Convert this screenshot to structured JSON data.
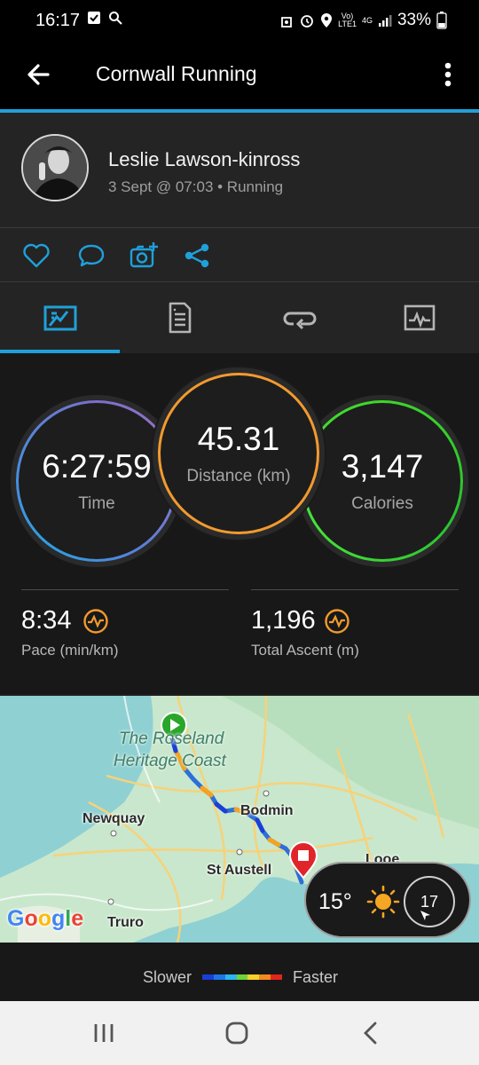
{
  "status_bar": {
    "time": "16:17",
    "network_top": "Vo)",
    "network_bottom": "LTE1",
    "net_type": "4G",
    "battery": "33%"
  },
  "app_bar": {
    "title": "Cornwall Running"
  },
  "profile": {
    "name": "Leslie Lawson-kinross",
    "meta": "3 Sept @ 07:03 • Running"
  },
  "stats": {
    "time": {
      "value": "6:27:59",
      "label": "Time",
      "color": "#7b7bd0"
    },
    "distance": {
      "value": "45.31",
      "label": "Distance (km)",
      "color": "#f29a2e"
    },
    "calories": {
      "value": "3,147",
      "label": "Calories",
      "color": "#3ed62a"
    },
    "pace": {
      "value": "8:34",
      "label": "Pace (min/km)"
    },
    "ascent": {
      "value": "1,196",
      "label": "Total Ascent (m)"
    }
  },
  "map": {
    "labels": {
      "region_line1": "The Roseland",
      "region_line2": "Heritage Coast",
      "bodmin": "Bodmin",
      "newquay": "Newquay",
      "st_austell": "St Austell",
      "looe": "Looe",
      "truro": "Truro"
    },
    "logo": {
      "g1": "G",
      "o1": "o",
      "o2": "o",
      "g2": "g",
      "l": "l",
      "e": "e"
    },
    "weather": {
      "temperature": "15°",
      "wind": "17"
    }
  },
  "legend": {
    "slower": "Slower",
    "faster": "Faster",
    "colors": [
      "#1b3fd6",
      "#1c76e8",
      "#2cb6ef",
      "#6fd43a",
      "#f4d22a",
      "#f48a1f",
      "#e1261c"
    ]
  },
  "icons": {
    "accent": "#1fa0da",
    "zone": "#f29a2e"
  }
}
